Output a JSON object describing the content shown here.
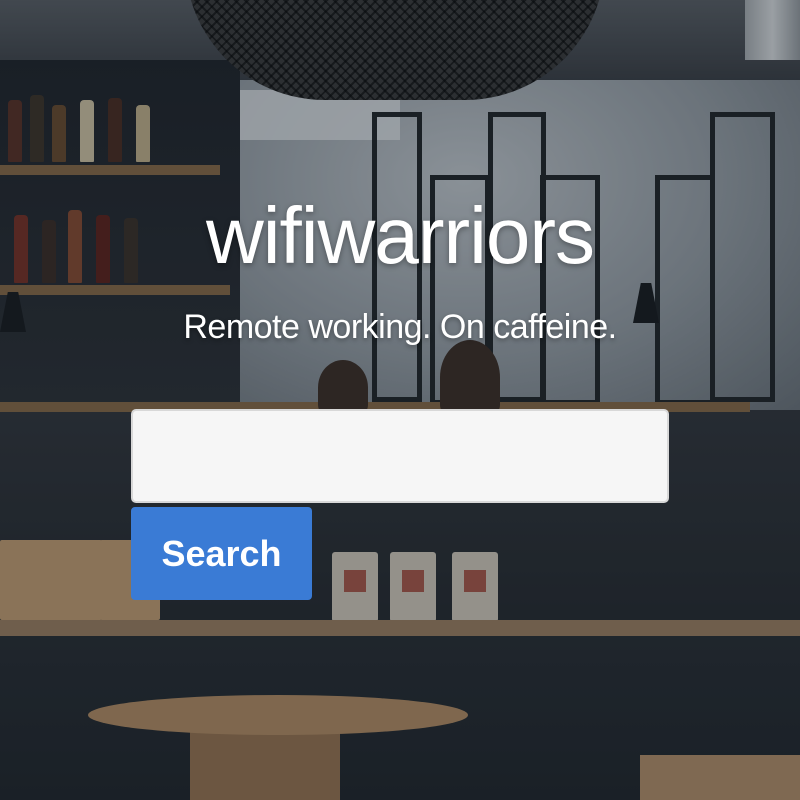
{
  "brand": {
    "name": "wifiwarriors",
    "tagline": "Remote working. On caffeine."
  },
  "search": {
    "value": "",
    "placeholder": "",
    "button_label": "Search"
  },
  "colors": {
    "button": "#3a7bd5",
    "input_background": "#f6f6f6",
    "text": "#ffffff"
  }
}
